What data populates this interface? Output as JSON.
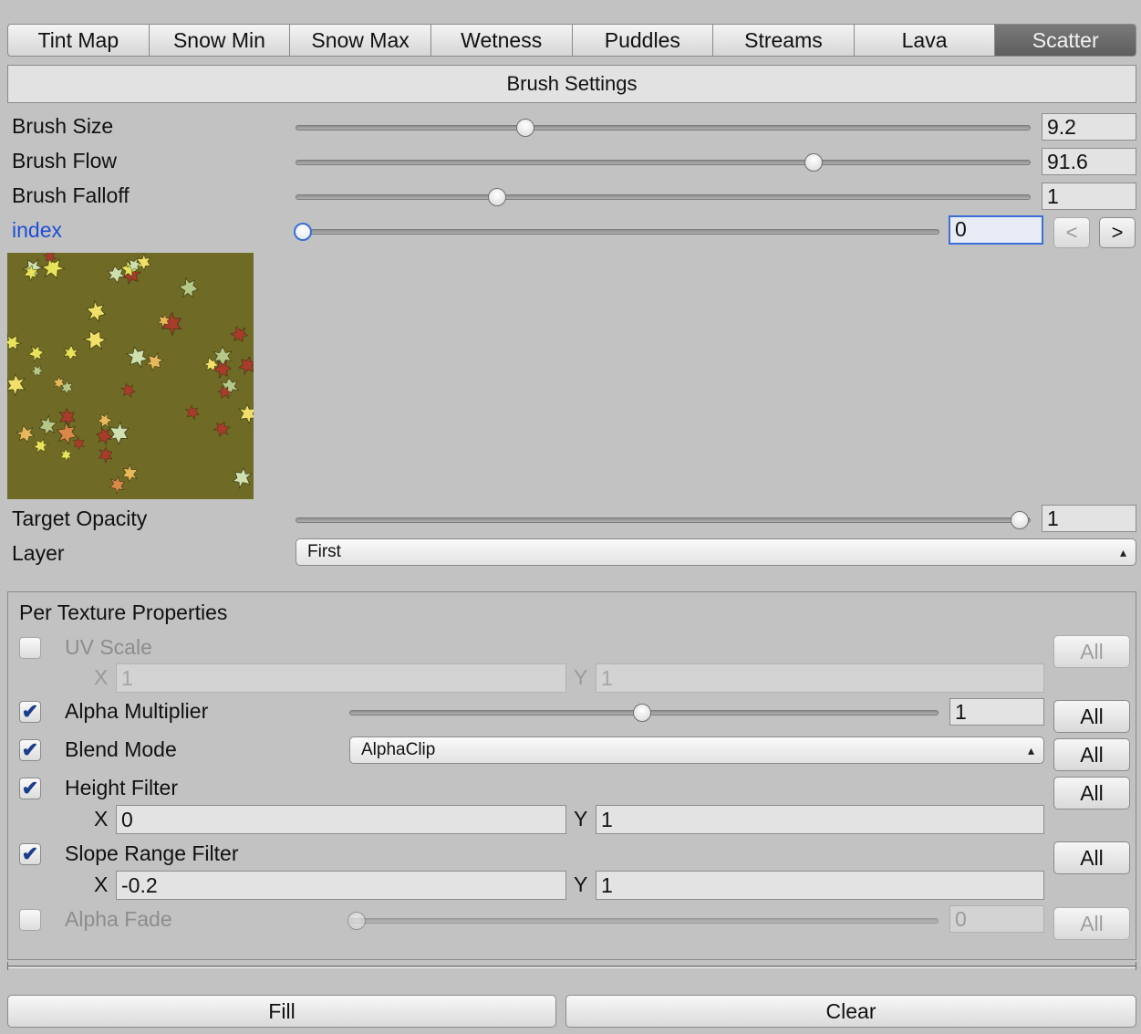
{
  "tabs": [
    "Tint Map",
    "Snow Min",
    "Snow Max",
    "Wetness",
    "Puddles",
    "Streams",
    "Lava",
    "Scatter"
  ],
  "active_tab": "Scatter",
  "brush_settings": {
    "title": "Brush Settings",
    "brush_size": {
      "label": "Brush Size",
      "value": "9.2",
      "level": 0.31
    },
    "brush_flow": {
      "label": "Brush Flow",
      "value": "91.6",
      "level": 0.713
    },
    "brush_falloff": {
      "label": "Brush Falloff",
      "value": "1",
      "level": 0.271
    },
    "index": {
      "label": "index",
      "value": "0",
      "level": 0.0,
      "prev": "<",
      "next": ">"
    },
    "target_opacity": {
      "label": "Target Opacity",
      "value": "1",
      "level": 1.0
    },
    "layer": {
      "label": "Layer",
      "value": "First"
    }
  },
  "per_texture": {
    "title": "Per Texture Properties",
    "all_label": "All",
    "uv_scale": {
      "label": "UV Scale",
      "checked": false,
      "x_label": "X",
      "x": "1",
      "y_label": "Y",
      "y": "1"
    },
    "alpha_multiplier": {
      "label": "Alpha Multiplier",
      "checked": true,
      "value": "1",
      "level": 0.5
    },
    "blend_mode": {
      "label": "Blend Mode",
      "checked": true,
      "value": "AlphaClip"
    },
    "height_filter": {
      "label": "Height Filter",
      "checked": true,
      "x_label": "X",
      "x": "0",
      "y_label": "Y",
      "y": "1"
    },
    "slope_range_filter": {
      "label": "Slope Range Filter",
      "checked": true,
      "x_label": "X",
      "x": "-0.2",
      "y_label": "Y",
      "y": "1"
    },
    "alpha_fade": {
      "label": "Alpha Fade",
      "checked": false,
      "value": "0",
      "level": 0.0
    }
  },
  "actions": {
    "fill": "Fill",
    "clear": "Clear"
  },
  "icons": {
    "checkmark": "checkmark-icon",
    "select_arrows": "updown-arrows-icon",
    "preview": "scatter-texture-preview"
  },
  "colors": {
    "focus": "#3b6fd8",
    "label_focus": "#1d4ed8",
    "active_tab": "#666666",
    "preview_bg": "#6f6a25"
  }
}
